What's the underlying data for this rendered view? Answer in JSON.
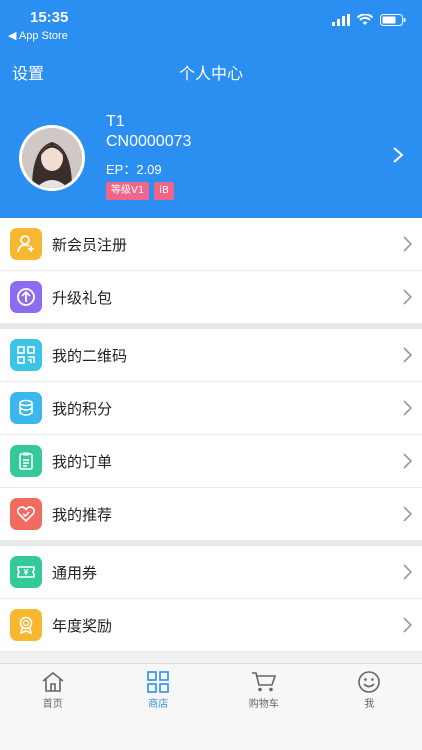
{
  "status": {
    "time": "15:35",
    "back_app": "◀ App Store"
  },
  "nav": {
    "settings": "设置",
    "title": "个人中心"
  },
  "profile": {
    "name": "T1",
    "id": "CN0000073",
    "ep": "EP：2.09",
    "badges": [
      "等级V1",
      "iB"
    ]
  },
  "menu_groups": [
    [
      {
        "label": "新会员注册",
        "icon": "user-plus-icon",
        "color": "#f7b731"
      },
      {
        "label": "升级礼包",
        "icon": "upgrade-arrow-icon",
        "color": "#8e6cf0"
      }
    ],
    [
      {
        "label": "我的二维码",
        "icon": "qrcode-icon",
        "color": "#3cc3e8"
      },
      {
        "label": "我的积分",
        "icon": "coins-icon",
        "color": "#3cb6ef"
      },
      {
        "label": "我的订单",
        "icon": "clipboard-icon",
        "color": "#35c99a"
      },
      {
        "label": "我的推荐",
        "icon": "heart-icon",
        "color": "#f06b60"
      }
    ],
    [
      {
        "label": "通用券",
        "icon": "coupon-icon",
        "color": "#35c99a"
      },
      {
        "label": "年度奖励",
        "icon": "award-icon",
        "color": "#f7b731"
      }
    ]
  ],
  "tabs": [
    {
      "label": "首页",
      "icon": "home-icon",
      "active": false
    },
    {
      "label": "商店",
      "icon": "grid-icon",
      "active": true
    },
    {
      "label": "购物车",
      "icon": "cart-icon",
      "active": false
    },
    {
      "label": "我",
      "icon": "smiley-icon",
      "active": false
    }
  ],
  "colors": {
    "primary": "#2b8ff2",
    "badge": "#f0668b"
  }
}
